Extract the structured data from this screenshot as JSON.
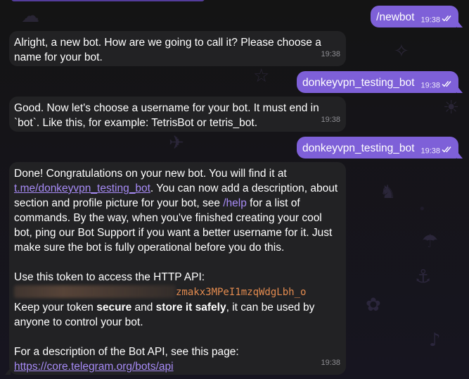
{
  "messages": {
    "m1": {
      "text": "/newbot",
      "time": "19:38"
    },
    "m2": {
      "text": "Alright, a new bot. How are we going to call it? Please choose a name for your bot.",
      "time": "19:38"
    },
    "m3": {
      "text": "donkeyvpn_testing_bot",
      "time": "19:38"
    },
    "m4": {
      "text": "Good. Now let's choose a username for your bot. It must end in `bot`. Like this, for example: TetrisBot or tetris_bot.",
      "time": "19:38"
    },
    "m5": {
      "text": "donkeyvpn_testing_bot",
      "time": "19:38"
    },
    "m6": {
      "line1": "Done! Congratulations on your new bot. You will find it at",
      "bot_link": "t.me/donkeyvpn_testing_bot",
      "after_link": ". You can now add a description, about section and profile picture for your bot, see ",
      "help_cmd": "/help",
      "after_help": " for a list of commands. By the way, when you've finished creating your cool bot, ping our Bot Support if you want a better username for it. Just make sure the bot is fully operational before you do this.",
      "token_intro": "Use this token to access the HTTP API:",
      "token_visible": "zmakx3MPeI1mzqWdgLbh_o",
      "keep_1": "Keep your token ",
      "keep_secure": "secure",
      "keep_and": " and ",
      "keep_store": "store it safely",
      "keep_2": ", it can be used by anyone to control your bot.",
      "api_intro": "For a description of the Bot API, see this page:",
      "api_link": "https://core.telegram.org/bots/api",
      "time": "19:38"
    }
  },
  "colors": {
    "outgoing_bubble": "#7e60d8",
    "incoming_bubble": "#222224",
    "link": "#a78bf6",
    "token": "#e38b4f"
  },
  "icons": {
    "read_receipt": "double-check-icon"
  }
}
